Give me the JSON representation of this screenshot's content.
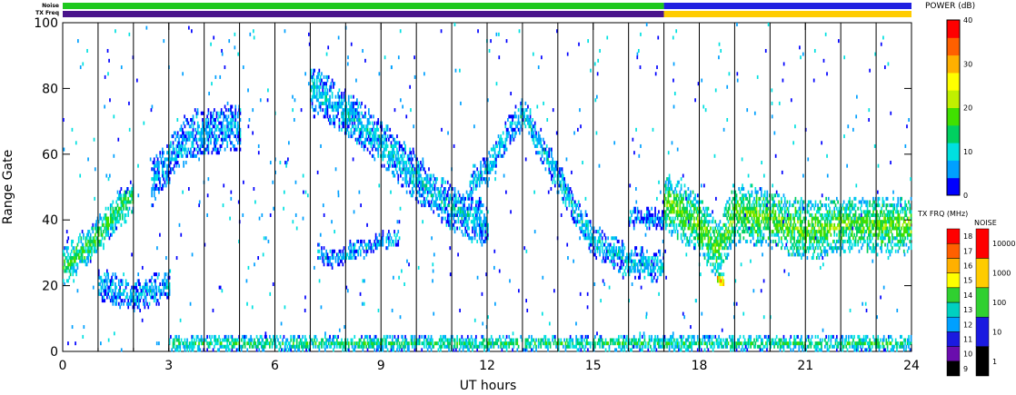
{
  "chart_data": {
    "type": "heatmap",
    "xlabel": "UT hours",
    "ylabel": "Range Gate",
    "xlim": [
      0,
      24
    ],
    "ylim": [
      0,
      100
    ],
    "x_ticks": [
      "0",
      "3",
      "6",
      "9",
      "12",
      "15",
      "18",
      "21",
      "24"
    ],
    "x_tick_values": [
      0,
      3,
      6,
      9,
      12,
      15,
      18,
      21,
      24
    ],
    "y_ticks": [
      "0",
      "20",
      "40",
      "60",
      "80",
      "100"
    ],
    "y_tick_values": [
      0,
      20,
      40,
      60,
      80,
      100
    ],
    "scan_boundaries_ut": [
      1,
      2,
      3,
      4,
      5,
      6,
      7,
      8,
      9,
      10,
      11,
      12,
      13,
      14,
      15,
      16,
      17,
      18,
      19,
      20,
      21,
      22,
      23
    ],
    "strip_labels": {
      "noise": "Noise",
      "txfreq": "TX Freq"
    },
    "noise_strip": [
      {
        "start": 0,
        "end": 17,
        "color": "#1ec81e"
      },
      {
        "start": 17,
        "end": 24,
        "color": "#2020e0"
      }
    ],
    "txfreq_strip": [
      {
        "start": 0,
        "end": 17,
        "color": "#4a148c"
      },
      {
        "start": 17,
        "end": 24,
        "color": "#ffcc00"
      }
    ],
    "power_colorbar": {
      "title": "POWER (dB)",
      "ticks": [
        "0",
        "10",
        "20",
        "30",
        "40"
      ],
      "tick_values": [
        0,
        10,
        20,
        30,
        40
      ],
      "range": [
        0,
        40
      ],
      "colors": [
        "#0000ff",
        "#00a0ff",
        "#00e0e0",
        "#00d060",
        "#40e000",
        "#c0f000",
        "#ffff00",
        "#ffb000",
        "#ff6000",
        "#ff0000"
      ]
    },
    "txfreq_legend": {
      "title": "TX FRQ (MHz)",
      "labels": [
        "9",
        "10",
        "11",
        "12",
        "13",
        "14",
        "15",
        "16",
        "17",
        "18"
      ],
      "colors": [
        "#000000",
        "#6a0dad",
        "#1a1ae0",
        "#00a0ff",
        "#00d0c0",
        "#30d030",
        "#ffff00",
        "#ffb000",
        "#ff6000",
        "#ff0000"
      ]
    },
    "noise_legend": {
      "title": "NOISE",
      "labels": [
        "1",
        "10",
        "100",
        "1000",
        "10000"
      ],
      "colors": [
        "#000000",
        "#1a1ae0",
        "#30d030",
        "#ffcc00",
        "#ff0000"
      ]
    },
    "echo_features": [
      {
        "name": "band_a",
        "points": [
          [
            0,
            25
          ],
          [
            0.5,
            30
          ],
          [
            1,
            35
          ],
          [
            1.5,
            42
          ],
          [
            2,
            47
          ]
        ],
        "spread": 5,
        "power": 16
      },
      {
        "name": "band_b",
        "points": [
          [
            1,
            20
          ],
          [
            1.5,
            18
          ],
          [
            2,
            16
          ],
          [
            2.5,
            18
          ],
          [
            3,
            20
          ]
        ],
        "spread": 4,
        "power": 8
      },
      {
        "name": "band_c",
        "points": [
          [
            2.5,
            50
          ],
          [
            3,
            58
          ],
          [
            3.5,
            64
          ],
          [
            4,
            66
          ],
          [
            5,
            68
          ]
        ],
        "spread": 6,
        "power": 7
      },
      {
        "name": "band_d",
        "points": [
          [
            7,
            80
          ],
          [
            8,
            72
          ],
          [
            9,
            63
          ],
          [
            10,
            52
          ],
          [
            11,
            43
          ],
          [
            12,
            38
          ]
        ],
        "spread": 6,
        "power": 9
      },
      {
        "name": "band_e",
        "points": [
          [
            7.2,
            30
          ],
          [
            7.5,
            27
          ],
          [
            8,
            29
          ],
          [
            9,
            33
          ],
          [
            9.5,
            34
          ]
        ],
        "spread": 2,
        "power": 8
      },
      {
        "name": "band_f",
        "points": [
          [
            11.5,
            50
          ],
          [
            12,
            55
          ],
          [
            12.5,
            65
          ],
          [
            13,
            72
          ],
          [
            13.5,
            62
          ],
          [
            14,
            52
          ],
          [
            14.5,
            42
          ],
          [
            15,
            33
          ],
          [
            16,
            27
          ],
          [
            17,
            25
          ]
        ],
        "spread": 4,
        "power": 9
      },
      {
        "name": "band_g",
        "points": [
          [
            16,
            40
          ],
          [
            17,
            40
          ]
        ],
        "spread": 3,
        "power": 6
      },
      {
        "name": "band_h",
        "points": [
          [
            17,
            45
          ],
          [
            18,
            38
          ],
          [
            18.5,
            30
          ],
          [
            19,
            42
          ],
          [
            20,
            40
          ],
          [
            21,
            36
          ],
          [
            22,
            38
          ],
          [
            23,
            38
          ],
          [
            24,
            38
          ]
        ],
        "spread": 8,
        "power": 18
      },
      {
        "name": "band_i",
        "points": [
          [
            18.5,
            22
          ],
          [
            18.7,
            20
          ]
        ],
        "spread": 2,
        "power": 30
      },
      {
        "name": "ground_clutter",
        "points": [
          [
            3,
            2
          ],
          [
            24,
            2
          ]
        ],
        "spread": 2,
        "power": 14
      }
    ]
  }
}
